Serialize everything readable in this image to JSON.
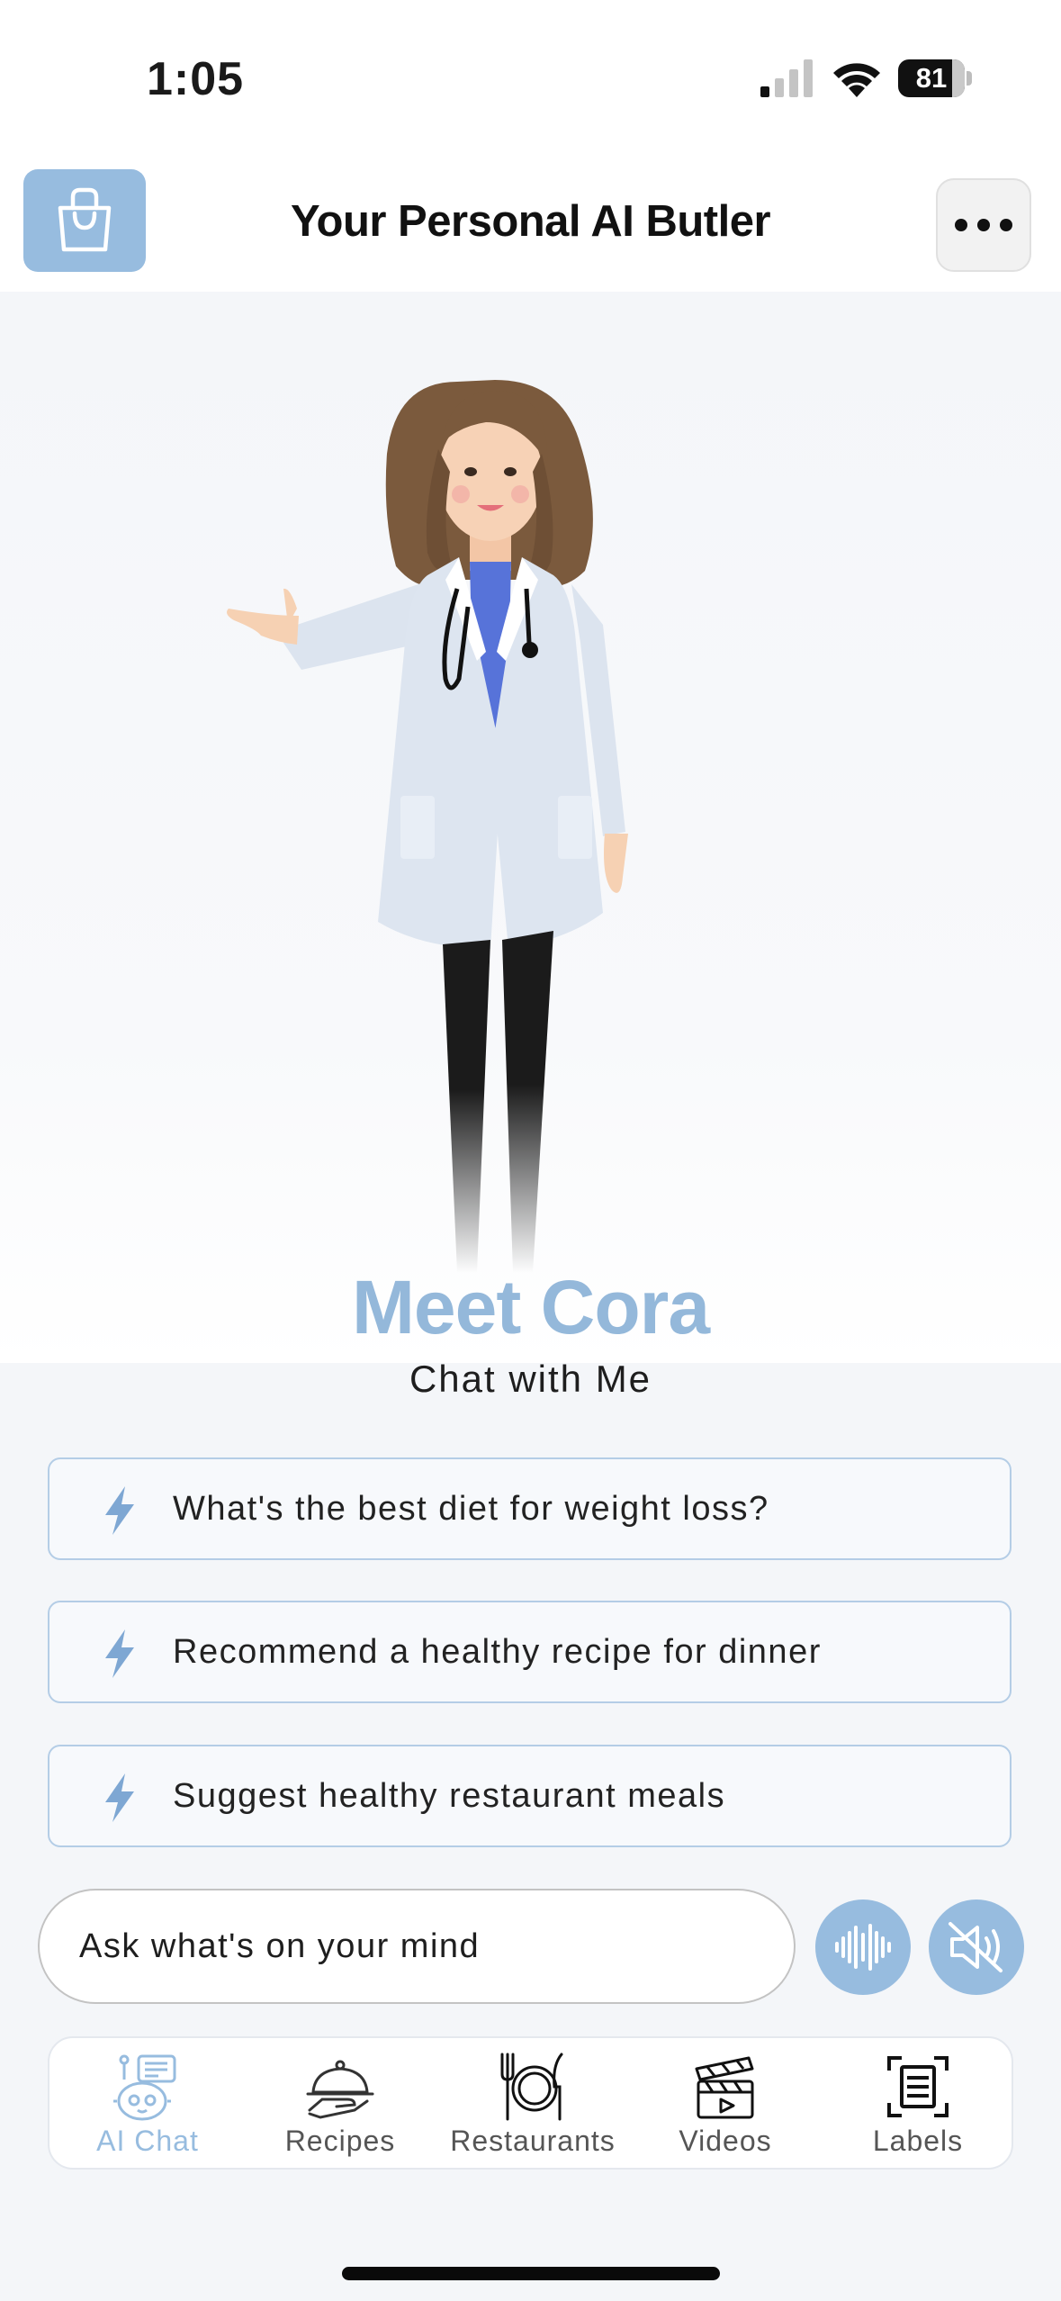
{
  "status_bar": {
    "time": "1:05",
    "battery": "81",
    "battery_level": 0.81
  },
  "header": {
    "title": "Your Personal AI Butler",
    "left_icon": "shopping-bag-icon",
    "right_icon": "more-dots-icon"
  },
  "hero": {
    "title": "Meet Cora",
    "subtitle": "Chat with Me"
  },
  "suggestions": [
    {
      "label": "What's the best diet for weight loss?",
      "icon": "bolt-icon"
    },
    {
      "label": "Recommend a healthy recipe for dinner",
      "icon": "bolt-icon"
    },
    {
      "label": "Suggest healthy restaurant meals",
      "icon": "bolt-icon"
    }
  ],
  "chat": {
    "placeholder": "Ask what's on your mind",
    "voice_icon": "voice-wave-icon",
    "mute_icon": "speaker-muted-icon"
  },
  "tabs": [
    {
      "label": "AI Chat",
      "icon": "robot-chat-icon",
      "active": true
    },
    {
      "label": "Recipes",
      "icon": "cloche-icon",
      "active": false
    },
    {
      "label": "Restaurants",
      "icon": "plate-cutlery-icon",
      "active": false
    },
    {
      "label": "Videos",
      "icon": "clapperboard-icon",
      "active": false
    },
    {
      "label": "Labels",
      "icon": "scan-label-icon",
      "active": false
    }
  ],
  "colors": {
    "accent": "#97bcdf",
    "accent_text": "#94b8da",
    "card_border": "#b4cde6",
    "background": "#f4f6f9"
  }
}
